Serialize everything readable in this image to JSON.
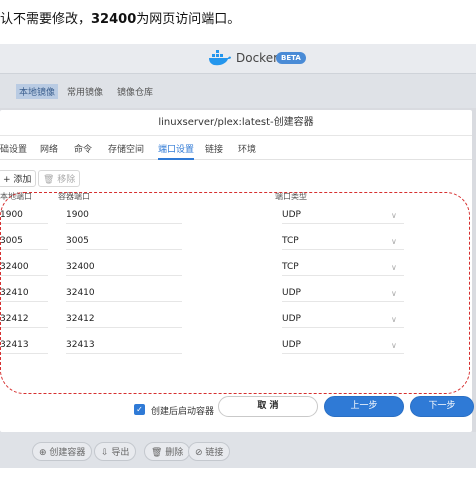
{
  "caption": {
    "prefix": "认不需要修改，",
    "port": "32400",
    "suffix": "为网页访问端口。"
  },
  "app": {
    "name": "Docker",
    "badge": "BETA"
  },
  "background_tabs": [
    "本地镜像",
    "常用镜像",
    "镜像仓库"
  ],
  "background_buttons": [
    "创建容器",
    "导出",
    "删除",
    "链接"
  ],
  "dialog": {
    "title": "linuxserver/plex:latest-创建容器",
    "tabs": [
      "础设置",
      "网络",
      "命令",
      "存储空间",
      "端口设置",
      "链接",
      "环境"
    ],
    "active_tab": "端口设置",
    "toolbar": {
      "add": "+ 添加",
      "remove": "🗑 移除"
    },
    "columns": {
      "local": "本地端口",
      "container": "容器端口",
      "type": "端口类型"
    },
    "rows": [
      {
        "local": "1900",
        "container": "1900",
        "type": "UDP"
      },
      {
        "local": "3005",
        "container": "3005",
        "type": "TCP"
      },
      {
        "local": "32400",
        "container": "32400",
        "type": "TCP"
      },
      {
        "local": "32410",
        "container": "32410",
        "type": "UDP"
      },
      {
        "local": "32412",
        "container": "32412",
        "type": "UDP"
      },
      {
        "local": "32413",
        "container": "32413",
        "type": "UDP"
      }
    ],
    "footer": {
      "checkbox_label": "创建后启动容器",
      "cancel": "取 消",
      "prev": "上一步",
      "next": "下一步"
    }
  },
  "colors": {
    "accent": "#2f7ad6",
    "highlight_dash": "#d62f2f"
  }
}
